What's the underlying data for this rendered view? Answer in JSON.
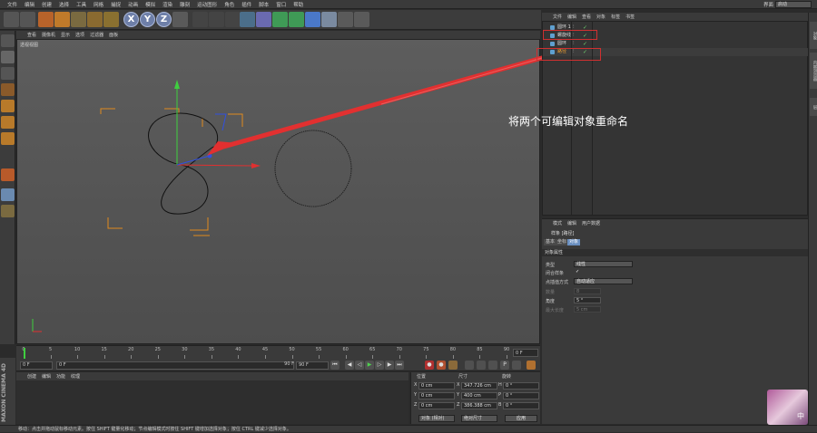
{
  "menubar": {
    "items": [
      "文件",
      "编辑",
      "创建",
      "选择",
      "工具",
      "网格",
      "捕捉",
      "动画",
      "模拟",
      "渲染",
      "雕刻",
      "运动图形",
      "角色",
      "插件",
      "脚本",
      "窗口",
      "帮助"
    ],
    "layout_label": "界面",
    "layout_value": "启动"
  },
  "toolbar": {
    "x": "X",
    "y": "Y",
    "z": "Z"
  },
  "viewport": {
    "menu": [
      "查看",
      "摄像机",
      "显示",
      "选项",
      "过滤器",
      "面板"
    ],
    "label": "透视视图"
  },
  "timeline": {
    "ticks": [
      "0",
      "5",
      "10",
      "15",
      "20",
      "25",
      "30",
      "35",
      "40",
      "45",
      "50",
      "55",
      "60",
      "65",
      "70",
      "75",
      "80",
      "85",
      "90"
    ],
    "end_frame": "0 F",
    "start_field": "0 F",
    "min_field": "0 F",
    "max_field": "90 F",
    "end_field": "90 F"
  },
  "material": {
    "menu": [
      "创建",
      "编辑",
      "功能",
      "纹理"
    ]
  },
  "brand": "MAXON CINEMA 4D",
  "coordinates": {
    "headers": [
      "位置",
      "尺寸",
      "旋转"
    ],
    "rows": [
      {
        "label": "X",
        "pos": "0 cm",
        "size_label": "X",
        "size": "347.726 cm",
        "rot_label": "H",
        "rot": "0 °"
      },
      {
        "label": "Y",
        "pos": "0 cm",
        "size_label": "Y",
        "size": "400 cm",
        "rot_label": "P",
        "rot": "0 °"
      },
      {
        "label": "Z",
        "pos": "0 cm",
        "size_label": "Z",
        "size": "386.388 cm",
        "rot_label": "B",
        "rot": "0 °"
      }
    ],
    "mode1": "对象 (相对)",
    "mode2": "绝对尺寸",
    "apply": "应用"
  },
  "status": "移动：点击并拖动鼠标移动元素。按住 SHIFT 键量化移动；节点编辑模式时按住 SHIFT 键增加选择对象；按住 CTRL 键减少选择对象。",
  "object_manager": {
    "menu": [
      "文件",
      "编辑",
      "查看",
      "对象",
      "标签",
      "书签"
    ],
    "rows": [
      {
        "name": "圆环 1"
      },
      {
        "name": "螺旋线"
      },
      {
        "name": "圆环"
      },
      {
        "name": "路径"
      }
    ]
  },
  "annotation": "将两个可编辑对象重命名",
  "attributes": {
    "menu": [
      "模式",
      "编辑",
      "用户数据"
    ],
    "title": "样条 [路径]",
    "tabs": [
      "基本",
      "坐标",
      "对象"
    ],
    "section": "对象属性",
    "rows": [
      {
        "label": "类型",
        "value": "线性"
      },
      {
        "label": "闭合样条",
        "value": "✓"
      },
      {
        "label": "点插值方式",
        "value": "自动适应"
      },
      {
        "label": "数量",
        "value": "8"
      },
      {
        "label": "角度",
        "value": "5 °"
      },
      {
        "label": "最大长度",
        "value": "5 cm"
      }
    ]
  },
  "right_tabs": [
    "对象",
    "内容浏览器",
    "层"
  ],
  "avatar_text": "中",
  "colors": {
    "accent_red": "#d03030",
    "axis_green": "#3fcf3f",
    "axis_red": "#e03030",
    "axis_blue": "#3050e0",
    "bracket_orange": "#e08a1e"
  }
}
